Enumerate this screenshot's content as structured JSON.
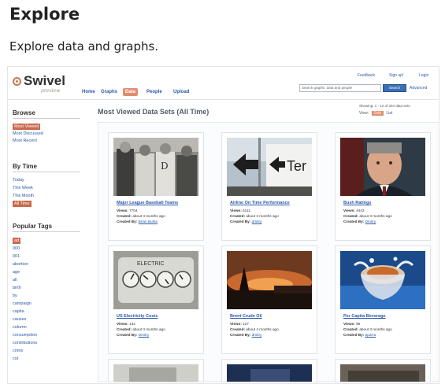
{
  "page": {
    "title": "Explore",
    "subtitle": "Explore data and graphs."
  },
  "app": {
    "logo": "Swivel",
    "logo_tag": "preview",
    "nav": [
      "Home",
      "Graphs",
      "Data",
      "People",
      "Upload"
    ],
    "active_nav": "Data",
    "top_links": [
      "Feedback",
      "Sign up!",
      "Login"
    ],
    "search_placeholder": "Search graphs, data and people",
    "search_button": "Search",
    "advanced_link": "Advanced"
  },
  "sidebar": {
    "browse_heading": "Browse",
    "browse": [
      "Most Viewed",
      "Most Discussed",
      "Most Recent"
    ],
    "by_time_heading": "By Time",
    "by_time": [
      "Today",
      "This Week",
      "This Month",
      "All Time"
    ],
    "tags_heading": "Popular Tags",
    "tags": [
      "ad",
      "000",
      "001",
      "abortion",
      "age",
      "all",
      "birth",
      "by",
      "campaign",
      "capita",
      "causes",
      "column",
      "consumption",
      "contributions",
      "crime",
      "cut"
    ]
  },
  "content": {
    "title": "Most Viewed Data Sets (All Time)",
    "showing": "Showing: 1 - 12 of 334 data sets",
    "view_label": "View:",
    "view_grid": "Grid",
    "view_list": "List"
  },
  "labels": {
    "views": "Views:",
    "created": "Created:",
    "created_by": "Created By:"
  },
  "cards": [
    {
      "title": "Major League Baseball Teams",
      "views": "7704",
      "created": "about 3 months ago",
      "by": "Brian Burke",
      "thumb": "baseball-photo"
    },
    {
      "title": "Airline On Time Performance",
      "views": "6111",
      "created": "about 3 months ago",
      "by": "dmitry",
      "thumb": "airport-sign-photo"
    },
    {
      "title": "Bush Ratings",
      "views": "4443",
      "created": "about 3 months ago",
      "by": "Dmitry",
      "thumb": "bush-portrait-photo"
    },
    {
      "title": "US Electricity Costs",
      "views": "132",
      "created": "about 3 months ago",
      "by": "Dmitry",
      "thumb": "electric-meter-photo"
    },
    {
      "title": "Brent Crude Oil",
      "views": "127",
      "created": "about 4 months ago",
      "by": "dmitry",
      "thumb": "oil-sunset-photo"
    },
    {
      "title": "Per Capita Beverage",
      "views": "96",
      "created": "about 3 months ago",
      "by": "pparra",
      "thumb": "beverage-splash-photo"
    }
  ]
}
